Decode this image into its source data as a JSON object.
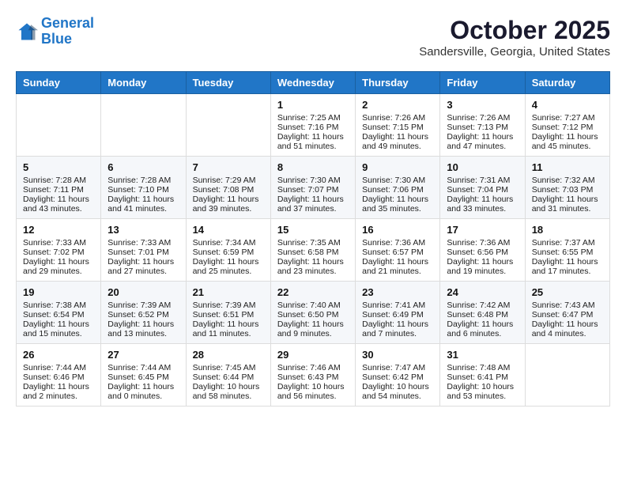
{
  "header": {
    "logo_line1": "General",
    "logo_line2": "Blue",
    "month": "October 2025",
    "location": "Sandersville, Georgia, United States"
  },
  "weekdays": [
    "Sunday",
    "Monday",
    "Tuesday",
    "Wednesday",
    "Thursday",
    "Friday",
    "Saturday"
  ],
  "weeks": [
    [
      {
        "day": "",
        "sunrise": "",
        "sunset": "",
        "daylight": ""
      },
      {
        "day": "",
        "sunrise": "",
        "sunset": "",
        "daylight": ""
      },
      {
        "day": "",
        "sunrise": "",
        "sunset": "",
        "daylight": ""
      },
      {
        "day": "1",
        "sunrise": "Sunrise: 7:25 AM",
        "sunset": "Sunset: 7:16 PM",
        "daylight": "Daylight: 11 hours and 51 minutes."
      },
      {
        "day": "2",
        "sunrise": "Sunrise: 7:26 AM",
        "sunset": "Sunset: 7:15 PM",
        "daylight": "Daylight: 11 hours and 49 minutes."
      },
      {
        "day": "3",
        "sunrise": "Sunrise: 7:26 AM",
        "sunset": "Sunset: 7:13 PM",
        "daylight": "Daylight: 11 hours and 47 minutes."
      },
      {
        "day": "4",
        "sunrise": "Sunrise: 7:27 AM",
        "sunset": "Sunset: 7:12 PM",
        "daylight": "Daylight: 11 hours and 45 minutes."
      }
    ],
    [
      {
        "day": "5",
        "sunrise": "Sunrise: 7:28 AM",
        "sunset": "Sunset: 7:11 PM",
        "daylight": "Daylight: 11 hours and 43 minutes."
      },
      {
        "day": "6",
        "sunrise": "Sunrise: 7:28 AM",
        "sunset": "Sunset: 7:10 PM",
        "daylight": "Daylight: 11 hours and 41 minutes."
      },
      {
        "day": "7",
        "sunrise": "Sunrise: 7:29 AM",
        "sunset": "Sunset: 7:08 PM",
        "daylight": "Daylight: 11 hours and 39 minutes."
      },
      {
        "day": "8",
        "sunrise": "Sunrise: 7:30 AM",
        "sunset": "Sunset: 7:07 PM",
        "daylight": "Daylight: 11 hours and 37 minutes."
      },
      {
        "day": "9",
        "sunrise": "Sunrise: 7:30 AM",
        "sunset": "Sunset: 7:06 PM",
        "daylight": "Daylight: 11 hours and 35 minutes."
      },
      {
        "day": "10",
        "sunrise": "Sunrise: 7:31 AM",
        "sunset": "Sunset: 7:04 PM",
        "daylight": "Daylight: 11 hours and 33 minutes."
      },
      {
        "day": "11",
        "sunrise": "Sunrise: 7:32 AM",
        "sunset": "Sunset: 7:03 PM",
        "daylight": "Daylight: 11 hours and 31 minutes."
      }
    ],
    [
      {
        "day": "12",
        "sunrise": "Sunrise: 7:33 AM",
        "sunset": "Sunset: 7:02 PM",
        "daylight": "Daylight: 11 hours and 29 minutes."
      },
      {
        "day": "13",
        "sunrise": "Sunrise: 7:33 AM",
        "sunset": "Sunset: 7:01 PM",
        "daylight": "Daylight: 11 hours and 27 minutes."
      },
      {
        "day": "14",
        "sunrise": "Sunrise: 7:34 AM",
        "sunset": "Sunset: 6:59 PM",
        "daylight": "Daylight: 11 hours and 25 minutes."
      },
      {
        "day": "15",
        "sunrise": "Sunrise: 7:35 AM",
        "sunset": "Sunset: 6:58 PM",
        "daylight": "Daylight: 11 hours and 23 minutes."
      },
      {
        "day": "16",
        "sunrise": "Sunrise: 7:36 AM",
        "sunset": "Sunset: 6:57 PM",
        "daylight": "Daylight: 11 hours and 21 minutes."
      },
      {
        "day": "17",
        "sunrise": "Sunrise: 7:36 AM",
        "sunset": "Sunset: 6:56 PM",
        "daylight": "Daylight: 11 hours and 19 minutes."
      },
      {
        "day": "18",
        "sunrise": "Sunrise: 7:37 AM",
        "sunset": "Sunset: 6:55 PM",
        "daylight": "Daylight: 11 hours and 17 minutes."
      }
    ],
    [
      {
        "day": "19",
        "sunrise": "Sunrise: 7:38 AM",
        "sunset": "Sunset: 6:54 PM",
        "daylight": "Daylight: 11 hours and 15 minutes."
      },
      {
        "day": "20",
        "sunrise": "Sunrise: 7:39 AM",
        "sunset": "Sunset: 6:52 PM",
        "daylight": "Daylight: 11 hours and 13 minutes."
      },
      {
        "day": "21",
        "sunrise": "Sunrise: 7:39 AM",
        "sunset": "Sunset: 6:51 PM",
        "daylight": "Daylight: 11 hours and 11 minutes."
      },
      {
        "day": "22",
        "sunrise": "Sunrise: 7:40 AM",
        "sunset": "Sunset: 6:50 PM",
        "daylight": "Daylight: 11 hours and 9 minutes."
      },
      {
        "day": "23",
        "sunrise": "Sunrise: 7:41 AM",
        "sunset": "Sunset: 6:49 PM",
        "daylight": "Daylight: 11 hours and 7 minutes."
      },
      {
        "day": "24",
        "sunrise": "Sunrise: 7:42 AM",
        "sunset": "Sunset: 6:48 PM",
        "daylight": "Daylight: 11 hours and 6 minutes."
      },
      {
        "day": "25",
        "sunrise": "Sunrise: 7:43 AM",
        "sunset": "Sunset: 6:47 PM",
        "daylight": "Daylight: 11 hours and 4 minutes."
      }
    ],
    [
      {
        "day": "26",
        "sunrise": "Sunrise: 7:44 AM",
        "sunset": "Sunset: 6:46 PM",
        "daylight": "Daylight: 11 hours and 2 minutes."
      },
      {
        "day": "27",
        "sunrise": "Sunrise: 7:44 AM",
        "sunset": "Sunset: 6:45 PM",
        "daylight": "Daylight: 11 hours and 0 minutes."
      },
      {
        "day": "28",
        "sunrise": "Sunrise: 7:45 AM",
        "sunset": "Sunset: 6:44 PM",
        "daylight": "Daylight: 10 hours and 58 minutes."
      },
      {
        "day": "29",
        "sunrise": "Sunrise: 7:46 AM",
        "sunset": "Sunset: 6:43 PM",
        "daylight": "Daylight: 10 hours and 56 minutes."
      },
      {
        "day": "30",
        "sunrise": "Sunrise: 7:47 AM",
        "sunset": "Sunset: 6:42 PM",
        "daylight": "Daylight: 10 hours and 54 minutes."
      },
      {
        "day": "31",
        "sunrise": "Sunrise: 7:48 AM",
        "sunset": "Sunset: 6:41 PM",
        "daylight": "Daylight: 10 hours and 53 minutes."
      },
      {
        "day": "",
        "sunrise": "",
        "sunset": "",
        "daylight": ""
      }
    ]
  ]
}
